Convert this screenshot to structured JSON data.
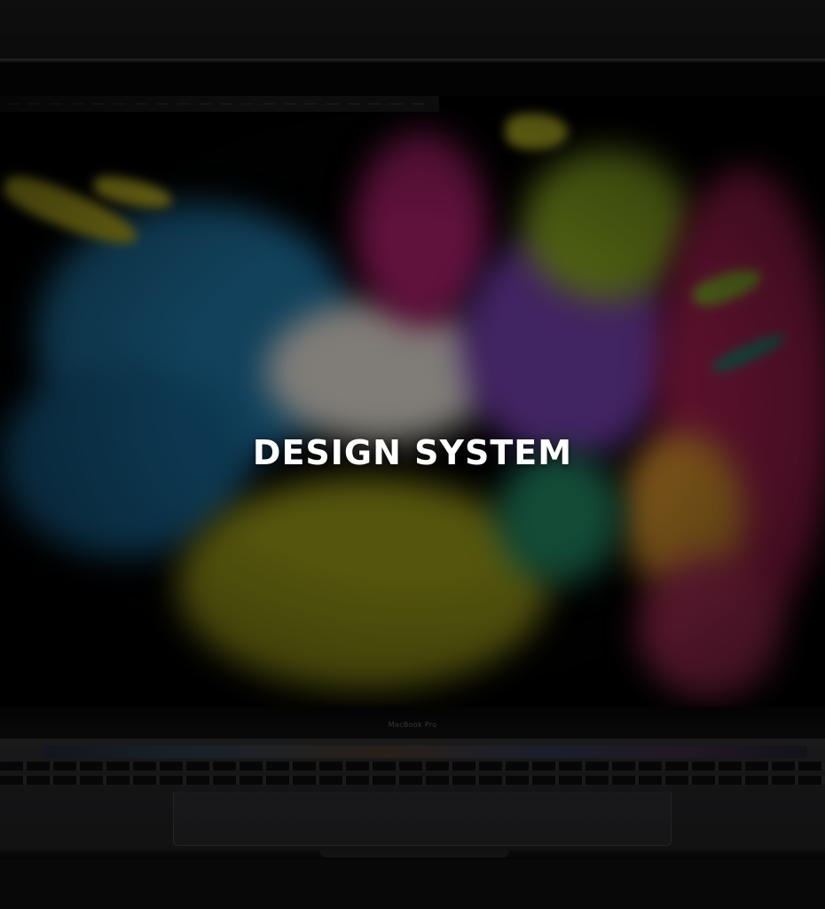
{
  "hero": {
    "title": "DESIGN SYSTEM",
    "overlay_color": "#000000",
    "title_color": "#ffffff"
  },
  "device": {
    "chin_label": "MacBook Pro"
  },
  "artwork": {
    "description_colors": [
      "#1f6e9a",
      "#9a1f5e",
      "#a6a21a",
      "#7a3a9a",
      "#d8d2c8"
    ]
  }
}
